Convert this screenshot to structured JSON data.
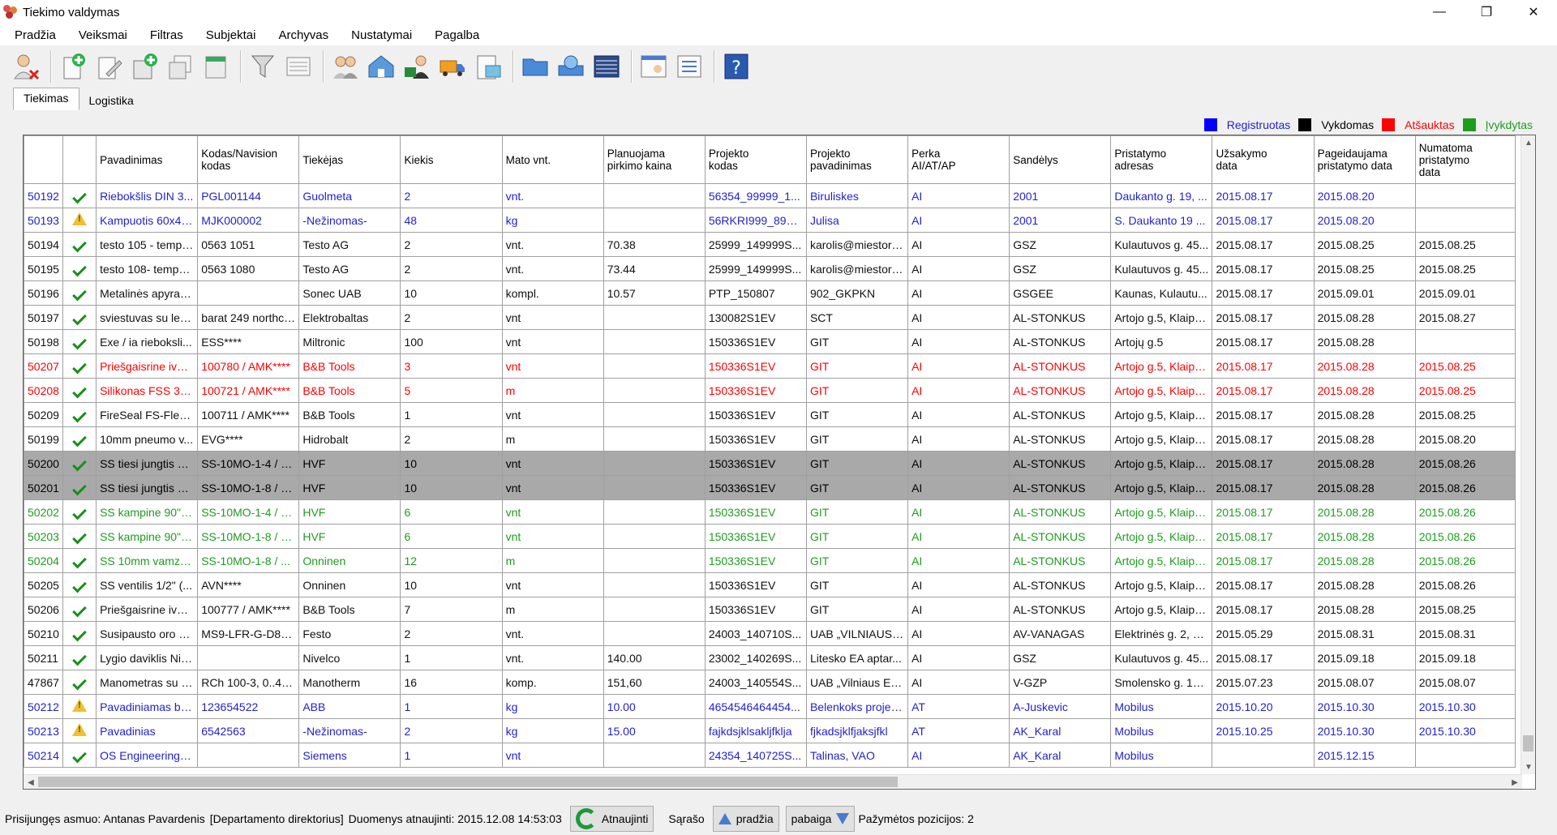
{
  "window": {
    "title": "Tiekimo valdymas"
  },
  "menu": [
    "Pradžia",
    "Veiksmai",
    "Filtras",
    "Subjektai",
    "Archyvas",
    "Nustatymai",
    "Pagalba"
  ],
  "tabs": [
    {
      "label": "Tiekimas",
      "active": true
    },
    {
      "label": "Logistika",
      "active": false
    }
  ],
  "legend": [
    {
      "label": "Registruotas",
      "color": "#0000ff",
      "text_color": "#1f1fcf"
    },
    {
      "label": "Vykdomas",
      "color": "#000000",
      "text_color": "#000000"
    },
    {
      "label": "Atšauktas",
      "color": "#ff0000",
      "text_color": "#ff0000"
    },
    {
      "label": "Įvykdytas",
      "color": "#1e9c1e",
      "text_color": "#1e9c1e"
    }
  ],
  "columns": [
    "",
    "",
    "Pavadinimas",
    "Kodas/Navision\nkodas",
    "Tiekėjas",
    "Kiekis",
    "Mato vnt.",
    "Planuojama\npirkimo kaina",
    "Projekto\nkodas",
    "Projekto\npavadinimas",
    "Perka\nAI/AT/AP",
    "Sandėlys",
    "Pristatymo\nadresas",
    "Užsakymo\ndata",
    "Pageidaujama\npristatymo data",
    "Numatoma\npristatymo\ndata"
  ],
  "rows": [
    {
      "id": "50192",
      "status": "registered",
      "icon": "check",
      "cells": [
        "Riebokšlis DIN 3...",
        "PGL001144",
        "Guolmeta",
        "2",
        "vnt.",
        "",
        "56354_99999_1...",
        "Biruliskes",
        "AI",
        "2001",
        "Daukanto g. 19, ...",
        "2015.08.17",
        "2015.08.20",
        ""
      ]
    },
    {
      "id": "50193",
      "status": "registered",
      "icon": "warn",
      "cells": [
        "Kampuotis 60x40...",
        "MJK000002",
        "-Nežinomas-",
        "48",
        "kg",
        "",
        "56RKRI999_89999",
        "Julisa",
        "AI",
        "2001",
        "S. Daukanto 19 ...",
        "2015.08.17",
        "2015.08.20",
        ""
      ]
    },
    {
      "id": "50194",
      "status": "active",
      "icon": "check",
      "cells": [
        "testo 105 - tempe...",
        "0563 1051",
        "Testo AG",
        "2",
        "vnt.",
        "70.38",
        "25999_149999S...",
        "karolis@miestore...",
        "AI",
        "GSZ",
        "Kulautuvos g. 45...",
        "2015.08.17",
        "2015.08.25",
        "2015.08.25"
      ]
    },
    {
      "id": "50195",
      "status": "active",
      "icon": "check",
      "cells": [
        "testo 108- temper...",
        "0563 1080",
        "Testo AG",
        "2",
        "vnt.",
        "73.44",
        "25999_149999S...",
        "karolis@miestore...",
        "AI",
        "GSZ",
        "Kulautuvos g. 45...",
        "2015.08.17",
        "2015.08.25",
        "2015.08.25"
      ]
    },
    {
      "id": "50196",
      "status": "active",
      "icon": "check",
      "cells": [
        "Metalinės apyran...",
        "",
        "Sonec UAB",
        "10",
        "kompl.",
        "10.57",
        "PTP_150807",
        "902_GKPKN",
        "AI",
        "GSGEE",
        "Kaunas, Kulautu...",
        "2015.08.17",
        "2015.09.01",
        "2015.09.01"
      ]
    },
    {
      "id": "50197",
      "status": "active",
      "icon": "check",
      "cells": [
        "sviestuvas su lem...",
        "barat 249 northcli...",
        "Elektrobaltas",
        "2",
        "vnt",
        "",
        "130082S1EV",
        "SCT",
        "AI",
        "AL-STONKUS",
        "Artojo g.5, Klaipėda",
        "2015.08.17",
        "2015.08.28",
        "2015.08.27"
      ]
    },
    {
      "id": "50198",
      "status": "active",
      "icon": "check",
      "cells": [
        "Exe / ia rieboksli...",
        "ESS****",
        "Miltronic",
        "100",
        "vnt",
        "",
        "150336S1EV",
        "GIT",
        "AI",
        "AL-STONKUS",
        "Artojų g.5",
        "2015.08.17",
        "2015.08.28",
        ""
      ]
    },
    {
      "id": "50207",
      "status": "cancelled",
      "icon": "check",
      "cells": [
        "Priešgaisrine ivor...",
        "100780 / AMK****",
        "B&B Tools",
        "3",
        "vnt",
        "",
        "150336S1EV",
        "GIT",
        "AI",
        "AL-STONKUS",
        "Artojo g.5, Klaipėda",
        "2015.08.17",
        "2015.08.28",
        "2015.08.25"
      ]
    },
    {
      "id": "50208",
      "status": "cancelled",
      "icon": "check",
      "cells": [
        "Silikonas FSS 30...",
        "100721 / AMK****",
        "B&B Tools",
        "5",
        "m",
        "",
        "150336S1EV",
        "GIT",
        "AI",
        "AL-STONKUS",
        "Artojo g.5, Klaipėda",
        "2015.08.17",
        "2015.08.28",
        "2015.08.25"
      ]
    },
    {
      "id": "50209",
      "status": "active",
      "icon": "check",
      "cells": [
        "FireSeal FS-Flex ...",
        "100711 / AMK****",
        "B&B Tools",
        "1",
        "vnt",
        "",
        "150336S1EV",
        "GIT",
        "AI",
        "AL-STONKUS",
        "Artojo g.5, Klaipėda",
        "2015.08.17",
        "2015.08.28",
        "2015.08.25"
      ]
    },
    {
      "id": "50199",
      "status": "active",
      "icon": "check",
      "cells": [
        "10mm pneumo v...",
        "EVG****",
        "Hidrobalt",
        "2",
        "m",
        "",
        "150336S1EV",
        "GIT",
        "AI",
        "AL-STONKUS",
        "Artojo g.5, Klaipėda",
        "2015.08.17",
        "2015.08.28",
        "2015.08.20"
      ]
    },
    {
      "id": "50200",
      "status": "active",
      "selected": true,
      "icon": "check",
      "cells": [
        "SS tiesi jungtis 1/...",
        "SS-10MO-1-4 / H...",
        "HVF",
        "10",
        "vnt",
        "",
        "150336S1EV",
        "GIT",
        "AI",
        "AL-STONKUS",
        "Artojo g.5, Klaipėda",
        "2015.08.17",
        "2015.08.28",
        "2015.08.26"
      ]
    },
    {
      "id": "50201",
      "status": "active",
      "selected": true,
      "icon": "check",
      "cells": [
        "SS tiesi jungtis 1/...",
        "SS-10MO-1-8 / H...",
        "HVF",
        "10",
        "vnt",
        "",
        "150336S1EV",
        "GIT",
        "AI",
        "AL-STONKUS",
        "Artojo g.5, Klaipėda",
        "2015.08.17",
        "2015.08.28",
        "2015.08.26"
      ]
    },
    {
      "id": "50202",
      "status": "completed",
      "icon": "check",
      "cells": [
        "SS kampine 90\" j...",
        "SS-10MO-1-4 / H...",
        "HVF",
        "6",
        "vnt",
        "",
        "150336S1EV",
        "GIT",
        "AI",
        "AL-STONKUS",
        "Artojo g.5, Klaipėda",
        "2015.08.17",
        "2015.08.28",
        "2015.08.26"
      ]
    },
    {
      "id": "50203",
      "status": "completed",
      "icon": "check",
      "cells": [
        "SS kampine 90\" j...",
        "SS-10MO-1-8 / H...",
        "HVF",
        "6",
        "vnt",
        "",
        "150336S1EV",
        "GIT",
        "AI",
        "AL-STONKUS",
        "Artojo g.5, Klaipėda",
        "2015.08.17",
        "2015.08.28",
        "2015.08.26"
      ]
    },
    {
      "id": "50204",
      "status": "completed",
      "icon": "check",
      "cells": [
        "SS 10mm vamzd...",
        "SS-10MO-1-8 / ...",
        "Onninen",
        "12",
        "m",
        "",
        "150336S1EV",
        "GIT",
        "AI",
        "AL-STONKUS",
        "Artojo g.5, Klaipėda",
        "2015.08.17",
        "2015.08.28",
        "2015.08.26"
      ]
    },
    {
      "id": "50205",
      "status": "active",
      "icon": "check",
      "cells": [
        "SS ventilis 1/2\" (...",
        "AVN****",
        "Onninen",
        "10",
        "vnt",
        "",
        "150336S1EV",
        "GIT",
        "AI",
        "AL-STONKUS",
        "Artojo g.5, Klaipėda",
        "2015.08.17",
        "2015.08.28",
        "2015.08.26"
      ]
    },
    {
      "id": "50206",
      "status": "active",
      "icon": "check",
      "cells": [
        "Priešgaisrine ivor...",
        "100777 / AMK****",
        "B&B Tools",
        "7",
        "m",
        "",
        "150336S1EV",
        "GIT",
        "AI",
        "AL-STONKUS",
        "Artojo g.5, Klaipėda",
        "2015.08.17",
        "2015.08.28",
        "2015.08.25"
      ]
    },
    {
      "id": "50210",
      "status": "active",
      "icon": "check",
      "cells": [
        "Susipausto oro p...",
        "MS9-LFR-G-D8-E...",
        "Festo",
        "2",
        "vnt.",
        "",
        "24003_140710S...",
        "UAB „VILNIAUS ...",
        "AI",
        "AV-VANAGAS",
        "Elektrinės g. 2, Vi...",
        "2015.05.29",
        "2015.08.31",
        "2015.08.31"
      ]
    },
    {
      "id": "50211",
      "status": "active",
      "icon": "check",
      "cells": [
        "Lygio daviklis Niv...",
        "",
        "Nivelco",
        "1",
        "vnt.",
        "140.00",
        "23002_140269S...",
        "Litesko EA aptar...",
        "AI",
        "GSZ",
        "Kulautuvos g. 45...",
        "2015.08.17",
        "2015.09.18",
        "2015.09.18"
      ]
    },
    {
      "id": "47867",
      "status": "active",
      "icon": "check",
      "cells": [
        "Manometras su m...",
        "RCh 100-3, 0..40...",
        "Manotherm",
        "16",
        "komp.",
        "151,60",
        "24003_140554S...",
        "UAB „Vilniaus En...",
        "AI",
        "V-GZP",
        "Smolensko g. 12,...",
        "2015.07.23",
        "2015.08.07",
        "2015.08.07"
      ]
    },
    {
      "id": "50212",
      "status": "registered",
      "icon": "warn",
      "cells": [
        "Pavadiniamas bel...",
        "123654522",
        "ABB",
        "1",
        "kg",
        "10.00",
        "4654546464454...",
        "Belenkoks projek...",
        "AT",
        "A-Juskevic",
        "Mobilus",
        "2015.10.20",
        "2015.10.30",
        "2015.10.30"
      ]
    },
    {
      "id": "50213",
      "status": "registered",
      "icon": "warn",
      "cells": [
        "Pavadinias",
        "6542563",
        "-Nežinomas-",
        "2",
        "kg",
        "15.00",
        "fajkdsjklsakljfklja",
        "fjkadsjklfjaksjfkl",
        "AT",
        "AK_Karal",
        "Mobilus",
        "2015.10.25",
        "2015.10.30",
        "2015.10.30"
      ]
    },
    {
      "id": "50214",
      "status": "registered",
      "icon": "check",
      "cells": [
        "OS Engineering 6...",
        "",
        "Siemens",
        "1",
        "vnt",
        "",
        "24354_140725S...",
        "Talinas, VAO",
        "AI",
        "AK_Karal",
        "Mobilus",
        "",
        "2015.12.15",
        ""
      ]
    }
  ],
  "statusbar": {
    "user": "Prisijungęs asmuo: Antanas Pavardenis",
    "department": "[Departamento direktorius]",
    "updated": "Duomenys atnaujinti: 2015.12.08 14:53:03",
    "refresh_label": "Atnaujinti",
    "list_label": "Sąrašo",
    "start_label": "pradžia",
    "end_label": "pabaiga",
    "marked": "Pažymėtos pozicijos: 2"
  }
}
